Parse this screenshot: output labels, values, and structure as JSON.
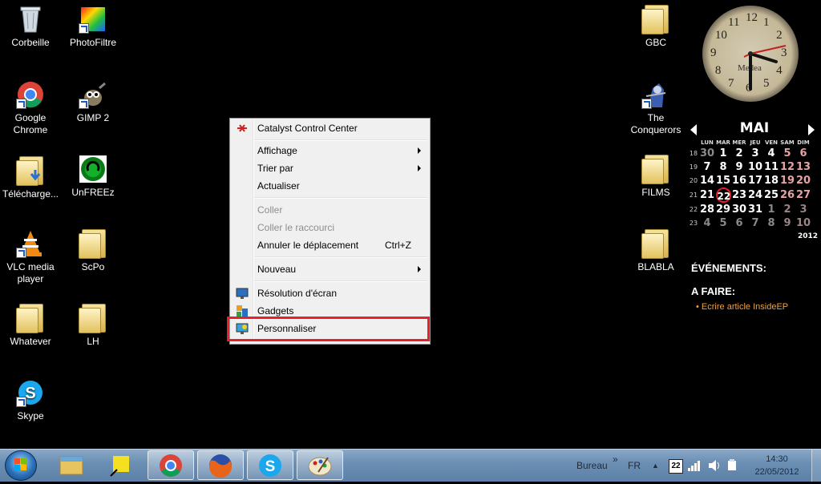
{
  "desktop": {
    "left_icons": [
      {
        "label": "Corbeille",
        "icon": "recycle-bin-icon"
      },
      {
        "label": "PhotoFiltre",
        "icon": "photofiltre-icon"
      },
      {
        "label": "Google Chrome",
        "icon": "chrome-icon"
      },
      {
        "label": "GIMP 2",
        "icon": "gimp-icon"
      },
      {
        "label": "Télécharge...",
        "icon": "downloads-folder-icon"
      },
      {
        "label": "UnFREEz",
        "icon": "unfreez-icon"
      },
      {
        "label": "VLC media player",
        "icon": "vlc-icon"
      },
      {
        "label": "ScPo",
        "icon": "folder-icon"
      },
      {
        "label": "Whatever",
        "icon": "folder-icon"
      },
      {
        "label": "LH",
        "icon": "folder-icon"
      },
      {
        "label": "Skype",
        "icon": "skype-icon"
      }
    ],
    "right_icons": [
      {
        "label": "GBC",
        "icon": "folder-icon"
      },
      {
        "label": "The Conquerors",
        "icon": "conquerors-icon"
      },
      {
        "label": "FILMS",
        "icon": "folder-icon"
      },
      {
        "label": "BLABLA",
        "icon": "folder-icon"
      }
    ]
  },
  "context_menu": {
    "items": [
      {
        "label": "Catalyst Control Center",
        "icon": "catalyst-icon"
      },
      {
        "label": "Affichage",
        "submenu": true
      },
      {
        "label": "Trier par",
        "submenu": true
      },
      {
        "label": "Actualiser"
      },
      {
        "label": "Coller",
        "disabled": true
      },
      {
        "label": "Coller le raccourci",
        "disabled": true
      },
      {
        "label": "Annuler le déplacement",
        "shortcut": "Ctrl+Z"
      },
      {
        "label": "Nouveau",
        "submenu": true
      },
      {
        "label": "Résolution d'écran",
        "icon": "display-icon"
      },
      {
        "label": "Gadgets",
        "icon": "gadgets-icon"
      },
      {
        "label": "Personnaliser",
        "icon": "personalize-icon",
        "highlighted": true
      }
    ],
    "highlight_color": "#e8202a"
  },
  "clock": {
    "brand": "Medea",
    "time": "14:30",
    "numbers": [
      "12",
      "1",
      "2",
      "3",
      "4",
      "5",
      "6",
      "7",
      "8",
      "9",
      "10",
      "11"
    ]
  },
  "calendar": {
    "month": "MAI",
    "year": "2012",
    "weekdays": [
      "LUN",
      "MAR",
      "MER",
      "JEU",
      "VEN",
      "SAM",
      "DIM"
    ],
    "weeks": [
      {
        "num": "18",
        "days": [
          "30",
          "1",
          "2",
          "3",
          "4",
          "5",
          "6"
        ]
      },
      {
        "num": "19",
        "days": [
          "7",
          "8",
          "9",
          "10",
          "11",
          "12",
          "13"
        ]
      },
      {
        "num": "20",
        "days": [
          "14",
          "15",
          "16",
          "17",
          "18",
          "19",
          "20"
        ]
      },
      {
        "num": "21",
        "days": [
          "21",
          "22",
          "23",
          "24",
          "25",
          "26",
          "27"
        ]
      },
      {
        "num": "22",
        "days": [
          "28",
          "29",
          "30",
          "31",
          "1",
          "2",
          "3"
        ]
      },
      {
        "num": "23",
        "days": [
          "4",
          "5",
          "6",
          "7",
          "8",
          "9",
          "10"
        ]
      }
    ],
    "today": "22",
    "today_color": "#e0202a",
    "events_title": "ÉVÉNEMENTS:",
    "todo_title": "A FAIRE:",
    "todo_items": [
      "Ecrire article InsideEP"
    ],
    "todo_color": "#f0a040"
  },
  "taskbar": {
    "apps": [
      "explorer-icon",
      "sticky-notes-icon",
      "chrome-icon",
      "firefox-icon",
      "skype-icon",
      "paint-icon"
    ],
    "toolbar_label": "Bureau",
    "toolbar_chevron": "»",
    "language": "FR",
    "time": "14:30",
    "date": "22/05/2012",
    "calendar_tray_day": "22"
  }
}
